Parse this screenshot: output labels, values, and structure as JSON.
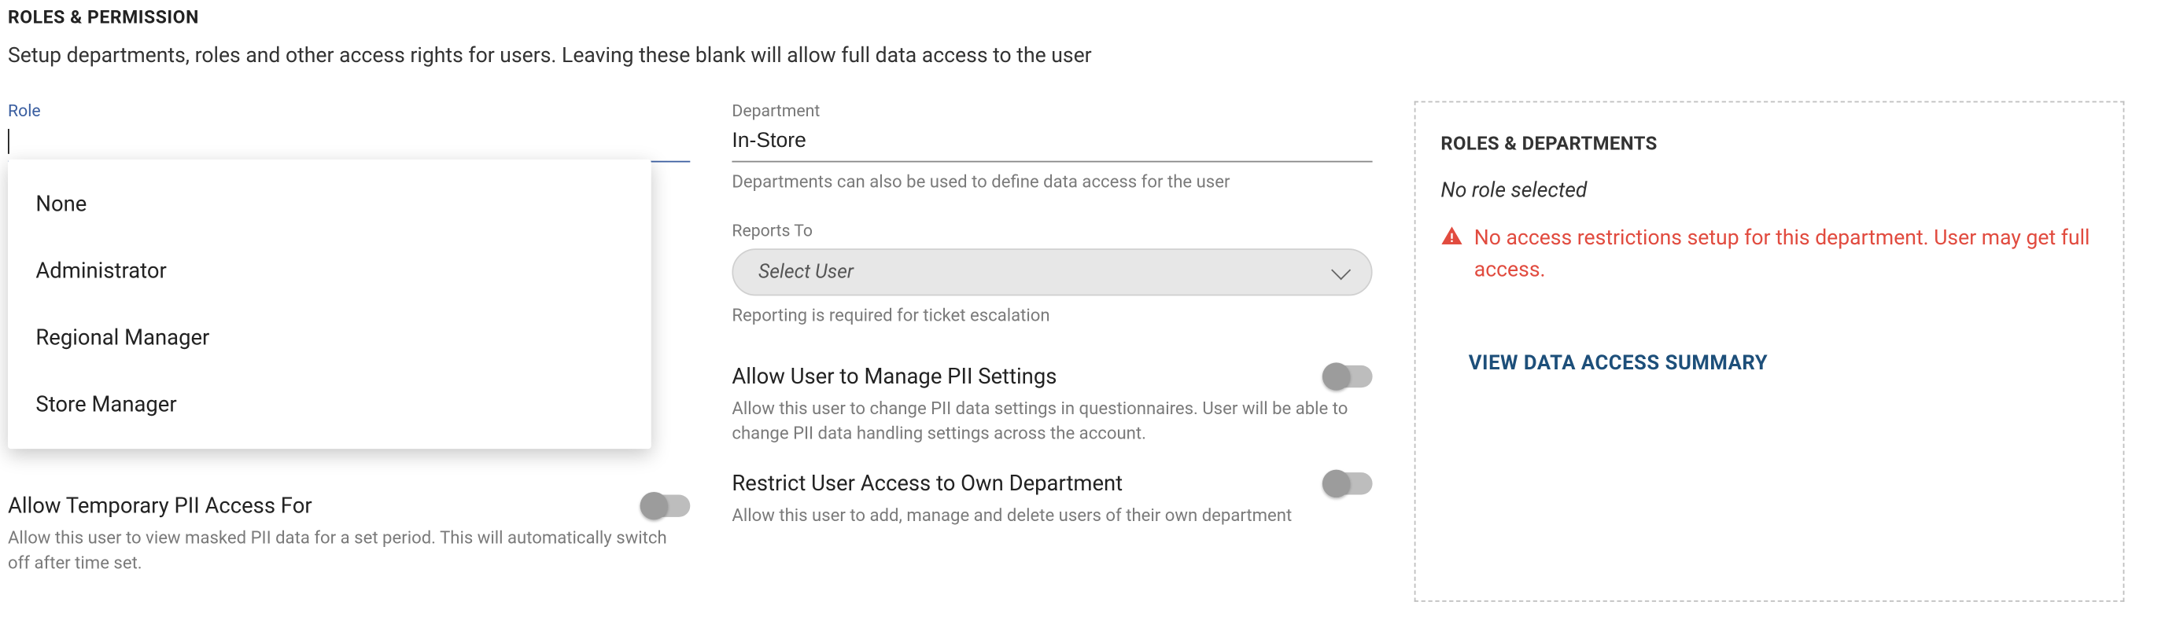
{
  "header": {
    "title": "ROLES & PERMISSION",
    "description": "Setup departments, roles and other access rights for users. Leaving these blank will allow full data access to the user"
  },
  "role": {
    "label": "Role",
    "value": "",
    "options": [
      "None",
      "Administrator",
      "Regional Manager",
      "Store Manager"
    ]
  },
  "department": {
    "label": "Department",
    "value": "In-Store",
    "hint": "Departments can also be used to define data access for the user"
  },
  "reports_to": {
    "label": "Reports To",
    "placeholder": "Select User",
    "hint": "Reporting is required for ticket escalation"
  },
  "toggles": {
    "pii_manage": {
      "title": "Allow User to Manage PII Settings",
      "hint": "Allow this user to change PII data settings in questionnaires. User will be able to change PII data handling settings across the account."
    },
    "restrict_dept": {
      "title": "Restrict User Access to Own Department",
      "hint": "Allow this user to add, manage and delete users of their own department"
    },
    "temp_pii": {
      "title": "Allow Temporary PII Access For",
      "hint": "Allow this user to view masked PII data for a set period. This will automatically switch off after time set."
    }
  },
  "summary": {
    "title": "ROLES & DEPARTMENTS",
    "no_role": "No role selected",
    "warning": "No access restrictions setup for this department. User may get full access.",
    "link": "VIEW DATA ACCESS SUMMARY"
  }
}
